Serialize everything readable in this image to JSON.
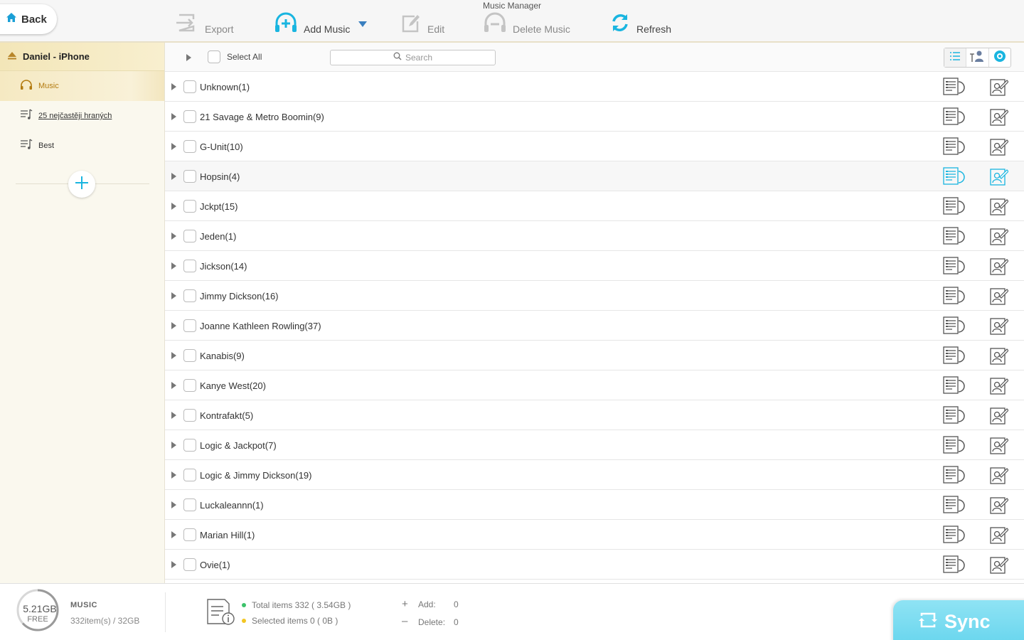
{
  "window": {
    "title": "Music Manager"
  },
  "toolbar": {
    "back_label": "Back",
    "export_label": "Export",
    "add_music_label": "Add Music",
    "edit_label": "Edit",
    "delete_label": "Delete Music",
    "refresh_label": "Refresh"
  },
  "sidebar": {
    "device_name": "Daniel - iPhone",
    "items": [
      {
        "label": "Music",
        "icon": "headphones-icon",
        "active": true
      },
      {
        "label": "25 nejčastěji hraných",
        "icon": "playlist-icon"
      },
      {
        "label": "Best",
        "icon": "playlist-icon"
      }
    ]
  },
  "list_header": {
    "select_all_label": "Select All",
    "search_placeholder": "Search"
  },
  "artists": [
    "Unknown(1)",
    "21 Savage & Metro Boomin(9)",
    "G-Unit(10)",
    "Hopsin(4)",
    "Jckpt(15)",
    "Jeden(1)",
    "Jickson(14)",
    "Jimmy Dickson(16)",
    "Joanne Kathleen Rowling(37)",
    "Kanabis(9)",
    "Kanye West(20)",
    "Kontrafakt(5)",
    "Logic & Jackpot(7)",
    "Logic & Jimmy Dickson(19)",
    "Luckaleannn(1)",
    "Marian Hill(1)",
    "Ovie(1)"
  ],
  "hovered_row": "Hopsin(4)",
  "footer": {
    "free_size": "5.21GB",
    "free_label": "FREE",
    "media_type": "MUSIC",
    "item_capacity": "332item(s) / 32GB",
    "total_items": "Total items 332 ( 3.54GB )",
    "selected_items": "Selected items 0 ( 0B )",
    "add_label": "Add:",
    "add_value": "0",
    "delete_label": "Delete:",
    "delete_value": "0",
    "sync_label": "Sync"
  },
  "colors": {
    "accent": "#19b5e0",
    "sidebar_active_text": "#b37b10",
    "total_dot": "#3cc26a",
    "selected_dot": "#f3c623",
    "sync_bg": "#7cdcf1"
  }
}
